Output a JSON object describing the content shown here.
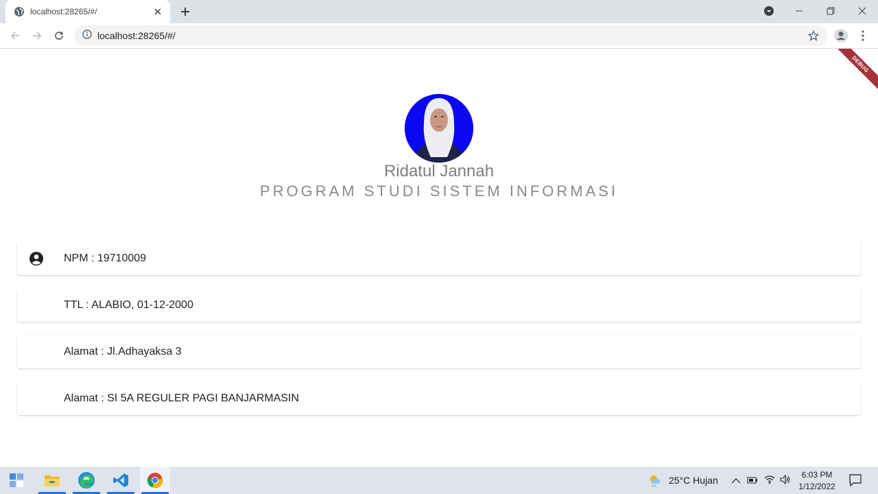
{
  "browser": {
    "tab_title": "localhost:28265/#/",
    "url": "localhost:28265/#/"
  },
  "debug_banner": "DEBUG",
  "profile": {
    "name": "Ridatul Jannah",
    "program": "PROGRAM STUDI SISTEM INFORMASI"
  },
  "info_items": [
    {
      "label": "NPM : 19710009",
      "icon": "account-circle-icon"
    },
    {
      "label": "TTL : ALABIO, 01-12-2000"
    },
    {
      "label": "Alamat : Jl.Adhayaksa 3"
    },
    {
      "label": "Alamat : SI 5A REGULER PAGI BANJARMASIN"
    }
  ],
  "taskbar": {
    "weather": "25°C  Hujan",
    "time": "6:03 PM",
    "date": "1/12/2022"
  },
  "colors": {
    "avatar_bg": "#0a08f0",
    "debug_banner": "#a6333a",
    "taskbar": "#dfe4ec"
  }
}
